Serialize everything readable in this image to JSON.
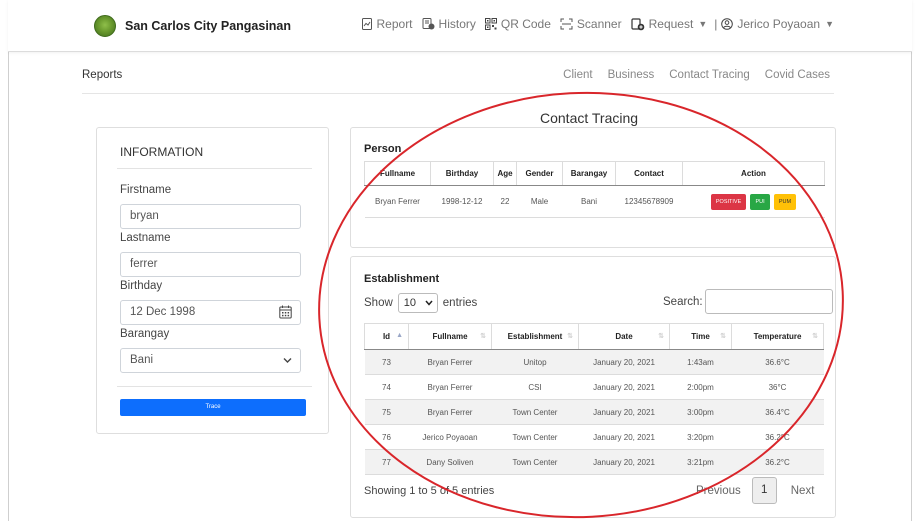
{
  "brand": {
    "name": "San Carlos City Pangasinan"
  },
  "nav": {
    "report": "Report",
    "history": "History",
    "qrcode": "QR Code",
    "scanner": "Scanner",
    "request": "Request",
    "separator": "|",
    "user": "Jerico Poyaoan"
  },
  "subheader": {
    "title": "Reports",
    "links": [
      "Client",
      "Business",
      "Contact Tracing",
      "Covid Cases"
    ]
  },
  "info": {
    "title": "INFORMATION",
    "firstname_label": "Firstname",
    "firstname_value": "bryan",
    "lastname_label": "Lastname",
    "lastname_value": "ferrer",
    "birthday_label": "Birthday",
    "birthday_value": "12 Dec 1998",
    "barangay_label": "Barangay",
    "barangay_value": "Bani",
    "trace_button": "Trace"
  },
  "contact_tracing": {
    "title": "Contact Tracing",
    "person": {
      "heading": "Person",
      "columns": [
        "Fullname",
        "Birthday",
        "Age",
        "Gender",
        "Barangay",
        "Contact",
        "Action"
      ],
      "row": {
        "fullname": "Bryan Ferrer",
        "birthday": "1998-12-12",
        "age": "22",
        "gender": "Male",
        "barangay": "Bani",
        "contact": "12345678909"
      },
      "actions": [
        "POSITIVE",
        "PUI",
        "PUM"
      ]
    },
    "establishment": {
      "heading": "Establishment",
      "show_label": "Show",
      "entries_value": "10",
      "entries_label": "entries",
      "search_label": "Search:",
      "columns": [
        "Id",
        "Fullname",
        "Establishment",
        "Date",
        "Time",
        "Temperature"
      ],
      "rows": [
        [
          "73",
          "Bryan Ferrer",
          "Unitop",
          "January 20, 2021",
          "1:43am",
          "36.6°C"
        ],
        [
          "74",
          "Bryan Ferrer",
          "CSI",
          "January 20, 2021",
          "2:00pm",
          "36°C"
        ],
        [
          "75",
          "Bryan Ferrer",
          "Town Center",
          "January 20, 2021",
          "3:00pm",
          "36.4°C"
        ],
        [
          "76",
          "Jerico Poyaoan",
          "Town Center",
          "January 20, 2021",
          "3:20pm",
          "36.2°C"
        ],
        [
          "77",
          "Dany Soliven",
          "Town Center",
          "January 20, 2021",
          "3:21pm",
          "36.2°C"
        ]
      ],
      "showing": "Showing 1 to 5 of 5 entries",
      "previous": "Previous",
      "page": "1",
      "next": "Next"
    }
  },
  "colors": {
    "primary": "#0d6efd",
    "positive": "#dc3545",
    "pui": "#28a745",
    "pum": "#ffc107",
    "annotation": "#d9262b"
  }
}
